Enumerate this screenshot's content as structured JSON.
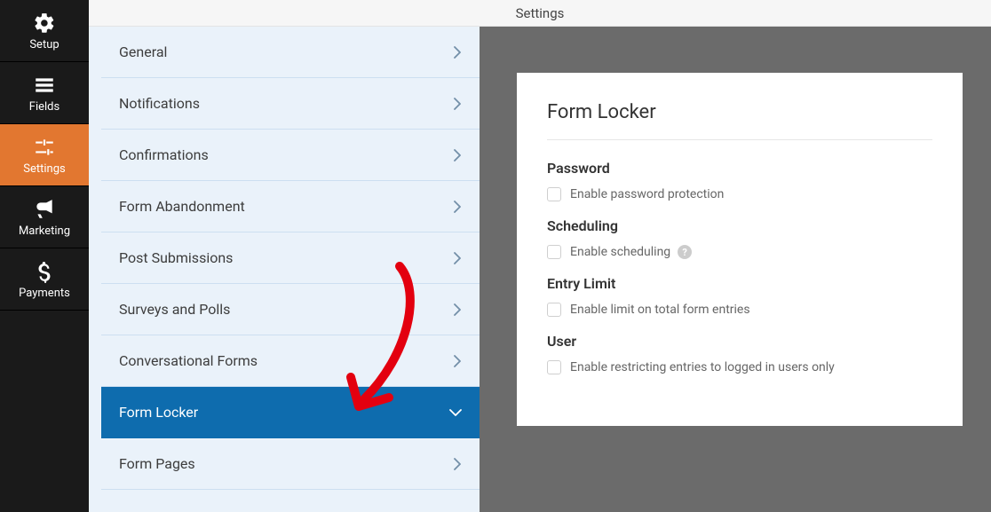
{
  "topbar": {
    "title": "Settings"
  },
  "rail": {
    "items": [
      {
        "label": "Setup"
      },
      {
        "label": "Fields"
      },
      {
        "label": "Settings"
      },
      {
        "label": "Marketing"
      },
      {
        "label": "Payments"
      }
    ]
  },
  "sections": {
    "items": [
      {
        "label": "General"
      },
      {
        "label": "Notifications"
      },
      {
        "label": "Confirmations"
      },
      {
        "label": "Form Abandonment"
      },
      {
        "label": "Post Submissions"
      },
      {
        "label": "Surveys and Polls"
      },
      {
        "label": "Conversational Forms"
      },
      {
        "label": "Form Locker"
      },
      {
        "label": "Form Pages"
      }
    ]
  },
  "panel": {
    "title": "Form Locker",
    "groups": {
      "password": {
        "heading": "Password",
        "checkbox_label": "Enable password protection"
      },
      "scheduling": {
        "heading": "Scheduling",
        "checkbox_label": "Enable scheduling"
      },
      "entry_limit": {
        "heading": "Entry Limit",
        "checkbox_label": "Enable limit on total form entries"
      },
      "user": {
        "heading": "User",
        "checkbox_label": "Enable restricting entries to logged in users only"
      }
    }
  }
}
